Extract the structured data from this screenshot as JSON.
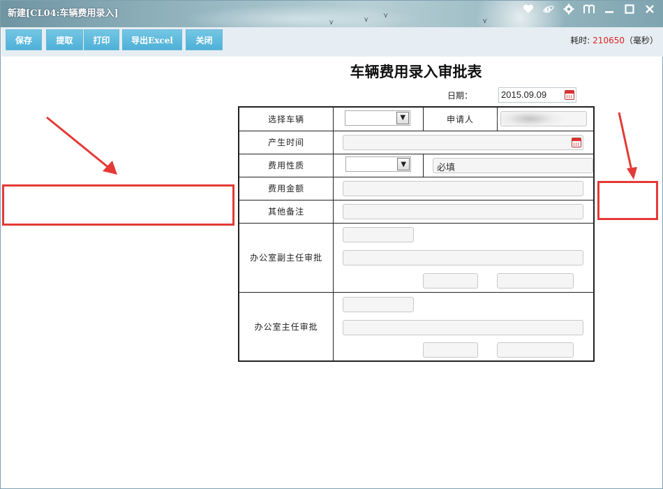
{
  "window": {
    "title": "新建[CL04:车辆费用录入]",
    "controls": [
      {
        "name": "favorite-icon",
        "glyph": "heart"
      },
      {
        "name": "ie-icon",
        "glyph": "e"
      },
      {
        "name": "settings-icon",
        "glyph": "gear"
      },
      {
        "name": "skin-icon",
        "glyph": "m"
      },
      {
        "name": "minimize-icon",
        "glyph": "minimize"
      },
      {
        "name": "maximize-icon",
        "glyph": "maximize"
      },
      {
        "name": "close-icon",
        "glyph": "close"
      }
    ]
  },
  "toolbar": {
    "buttons": [
      "保存",
      "提取",
      "打印",
      "导出Excel",
      "关闭"
    ],
    "timing_label": "耗时:",
    "timing_value": "210650",
    "timing_unit": "（毫秒）"
  },
  "form": {
    "title": "车辆费用录入审批表",
    "date_label": "日期：",
    "date_value": "2015.09.09",
    "rows": {
      "vehicle": "选择车辆",
      "applicant": "申请人",
      "time": "产生时间",
      "nature": "费用性质",
      "nature_placeholder": "必填",
      "amount": "费用金额",
      "remarks": "其他备注",
      "deputy_approval": "办公室副主任审批",
      "director_approval": "办公室主任审批"
    }
  },
  "colors": {
    "toolbar_button": "#5bb8dd",
    "annotation": "#e53935",
    "timing_value": "#dd2222"
  }
}
